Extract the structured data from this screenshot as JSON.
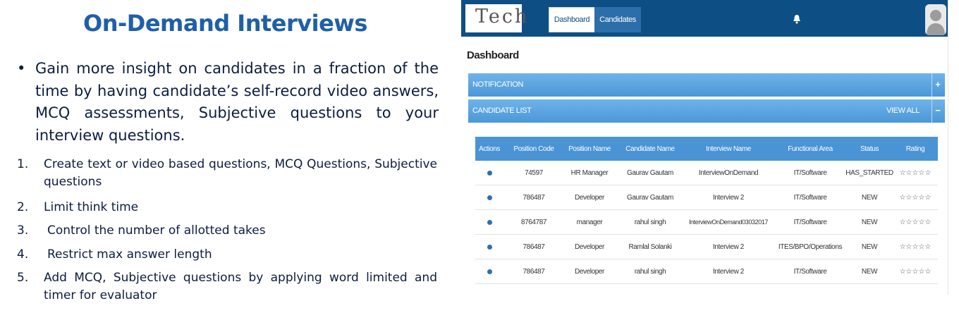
{
  "slide": {
    "title": "On-Demand Interviews",
    "bullet": "Gain more insight on candidates in a fraction of the time by having candidate’s self-record video answers, MCQ assessments, Subjective questions to your interview questions.",
    "numbered": [
      {
        "num": "1.",
        "text": "Create text or video based questions, MCQ Questions, Subjective questions"
      },
      {
        "num": "2.",
        "text": "Limit think time"
      },
      {
        "num": "3.",
        "text": "Control the number of allotted takes"
      },
      {
        "num": "4.",
        "text": "Restrict max answer length"
      },
      {
        "num": "5.",
        "text": "Add MCQ, Subjective questions by applying word limited and timer for evaluator"
      }
    ]
  },
  "app": {
    "logo_text": "Tech",
    "nav": {
      "dashboard": "Dashboard",
      "candidates": "Candidates"
    },
    "page_title": "Dashboard",
    "notification_label": "NOTIFICATION",
    "notification_toggle": "+",
    "candidate_list_label": "CANDIDATE LIST",
    "view_all": "VIEW ALL",
    "candidate_list_toggle": "−",
    "table": {
      "headers": [
        "Actions",
        "Position Code",
        "Position Name",
        "Candidate Name",
        "Interview Name",
        "Functional Area",
        "Status",
        "Rating"
      ],
      "rows": [
        {
          "code": "74597",
          "position": "HR Manager",
          "candidate": "Gaurav Gautam",
          "interview": "InterviewOnDemand",
          "area": "IT/Software",
          "status": "HAS_STARTED",
          "rating": "☆☆☆☆☆"
        },
        {
          "code": "786487",
          "position": "Developer",
          "candidate": "Gaurav Gautam",
          "interview": "Interview 2",
          "area": "IT/Software",
          "status": "NEW",
          "rating": "☆☆☆☆☆"
        },
        {
          "code": "8764787",
          "position": "manager",
          "candidate": "rahul singh",
          "interview": "InterviewOnDemand03032017",
          "area": "IT/Software",
          "status": "NEW",
          "rating": "☆☆☆☆☆"
        },
        {
          "code": "786487",
          "position": "Developer",
          "candidate": "Ramlal Solanki",
          "interview": "Interview 2",
          "area": "ITES/BPO/Operations",
          "status": "NEW",
          "rating": "☆☆☆☆☆"
        },
        {
          "code": "786487",
          "position": "Developer",
          "candidate": "rahul singh",
          "interview": "Interview 2",
          "area": "IT/Software",
          "status": "NEW",
          "rating": "☆☆☆☆☆"
        }
      ]
    }
  },
  "colors": {
    "title_blue": "#1f5fa8",
    "topbar": "#0d4f84",
    "bar": "#4b97d8",
    "header": "#4a94d6"
  }
}
